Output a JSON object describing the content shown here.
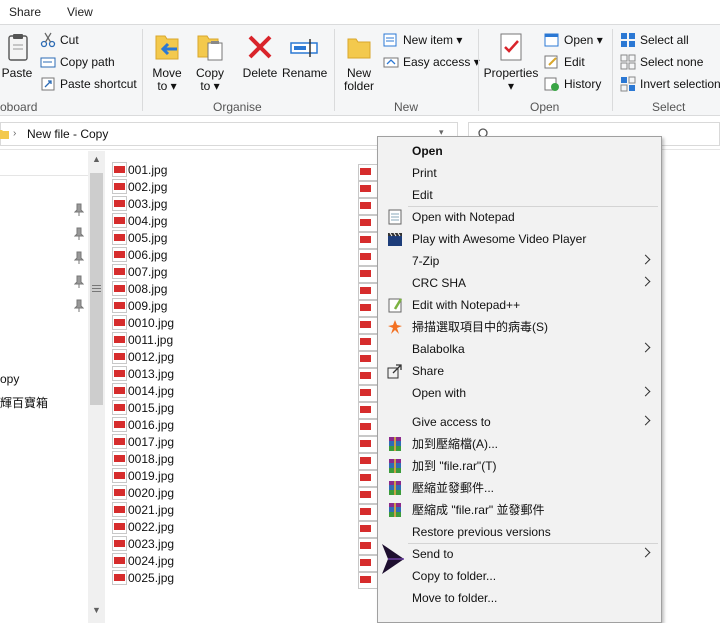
{
  "tabs": {
    "share": "Share",
    "view": "View"
  },
  "ribbon": {
    "clipboard": {
      "paste": "Paste",
      "cut": "Cut",
      "copy_path": "Copy path",
      "paste_shortcut": "Paste shortcut",
      "group": "oboard"
    },
    "organise": {
      "move_to": "Move",
      "move_to2": "to",
      "copy_to": "Copy",
      "copy_to2": "to",
      "delete": "Delete",
      "rename": "Rename",
      "group": "Organise"
    },
    "new": {
      "new_folder": "New",
      "new_folder2": "folder",
      "new_item": "New item",
      "easy_access": "Easy access",
      "group": "New"
    },
    "open": {
      "properties": "Properties",
      "open": "Open",
      "edit": "Edit",
      "history": "History",
      "group": "Open"
    },
    "select": {
      "select_all": "Select all",
      "select_none": "Select none",
      "invert": "Invert selection",
      "group": "Select"
    }
  },
  "address": {
    "path": "New file - Copy"
  },
  "nav": {
    "item1": "opy",
    "item2": "輝百寶箱"
  },
  "files": [
    "001.jpg",
    "002.jpg",
    "003.jpg",
    "004.jpg",
    "005.jpg",
    "006.jpg",
    "007.jpg",
    "008.jpg",
    "009.jpg",
    "0010.jpg",
    "0011.jpg",
    "0012.jpg",
    "0013.jpg",
    "0014.jpg",
    "0015.jpg",
    "0016.jpg",
    "0017.jpg",
    "0018.jpg",
    "0019.jpg",
    "0020.jpg",
    "0021.jpg",
    "0022.jpg",
    "0023.jpg",
    "0024.jpg",
    "0025.jpg"
  ],
  "menu": {
    "items": [
      {
        "label": "Open",
        "bold": true,
        "icon": "",
        "sub": false
      },
      {
        "label": "Print",
        "bold": false,
        "icon": "",
        "sub": false
      },
      {
        "label": "Edit",
        "bold": false,
        "icon": "",
        "sub": false
      },
      {
        "label": "Open with Notepad",
        "bold": false,
        "icon": "notepad-icon",
        "sub": false
      },
      {
        "label": "Play with Awesome Video Player",
        "bold": false,
        "icon": "clapperboard-icon",
        "sub": false
      },
      {
        "label": "7-Zip",
        "bold": false,
        "icon": "",
        "sub": true
      },
      {
        "label": "CRC SHA",
        "bold": false,
        "icon": "",
        "sub": true
      },
      {
        "label": "Edit with Notepad++",
        "bold": false,
        "icon": "notepadpp-icon",
        "sub": false
      },
      {
        "label": "掃描選取項目中的病毒(S)",
        "bold": false,
        "icon": "avast-icon",
        "sub": false
      },
      {
        "label": "Balabolka",
        "bold": false,
        "icon": "",
        "sub": true
      },
      {
        "label": "Share",
        "bold": false,
        "icon": "share-icon",
        "sub": false
      },
      {
        "label": "Open with",
        "bold": false,
        "icon": "",
        "sub": true
      },
      {
        "label": "Give access to",
        "bold": false,
        "icon": "",
        "sub": true
      },
      {
        "label": "加到壓縮檔(A)...",
        "bold": false,
        "icon": "winrar-icon",
        "sub": false
      },
      {
        "label": "加到 \"file.rar\"(T)",
        "bold": false,
        "icon": "winrar-icon",
        "sub": false
      },
      {
        "label": "壓縮並發郵件...",
        "bold": false,
        "icon": "winrar-icon",
        "sub": false
      },
      {
        "label": "壓縮成 \"file.rar\" 並發郵件",
        "bold": false,
        "icon": "winrar-icon",
        "sub": false
      },
      {
        "label": "Restore previous versions",
        "bold": false,
        "icon": "",
        "sub": false
      },
      {
        "label": "Send to",
        "bold": false,
        "icon": "",
        "sub": true
      },
      {
        "label": "Copy to folder...",
        "bold": false,
        "icon": "",
        "sub": false
      },
      {
        "label": "Move to folder...",
        "bold": false,
        "icon": "",
        "sub": false
      }
    ]
  },
  "colors": {
    "accent": "#2b78d4",
    "delete_red": "#d9242b",
    "jpg_red": "#d62c2c",
    "menu_bg": "#f2f2f2"
  }
}
